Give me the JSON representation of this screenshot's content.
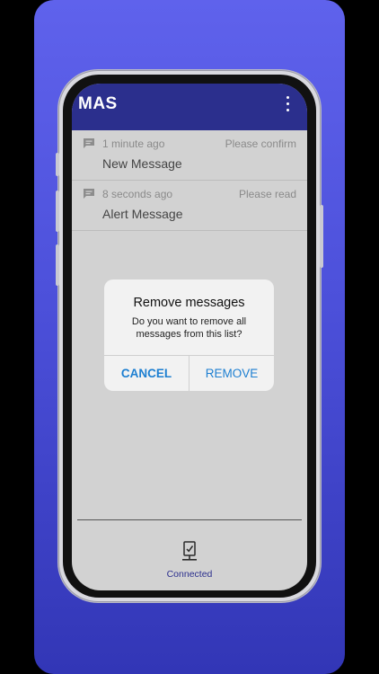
{
  "app": {
    "title": "MAS"
  },
  "messages": [
    {
      "time": "1 minute ago",
      "status": "Please confirm",
      "title": "New Message"
    },
    {
      "time": "8 seconds ago",
      "status": "Please read",
      "title": "Alert Message"
    }
  ],
  "dialog": {
    "title": "Remove messages",
    "message": "Do you want to remove all messages from this list?",
    "cancel_label": "CANCEL",
    "remove_label": "REMOVE"
  },
  "footer": {
    "status_label": "Connected",
    "status_icon": "connected-device-icon"
  },
  "colors": {
    "appbar": "#2b2f8d",
    "accent": "#1d7fd1",
    "backdrop_top": "#5f62ec",
    "backdrop_bottom": "#3236b6"
  },
  "icons": {
    "message": "chat-bubble-icon",
    "menu": "more-vert-icon"
  }
}
